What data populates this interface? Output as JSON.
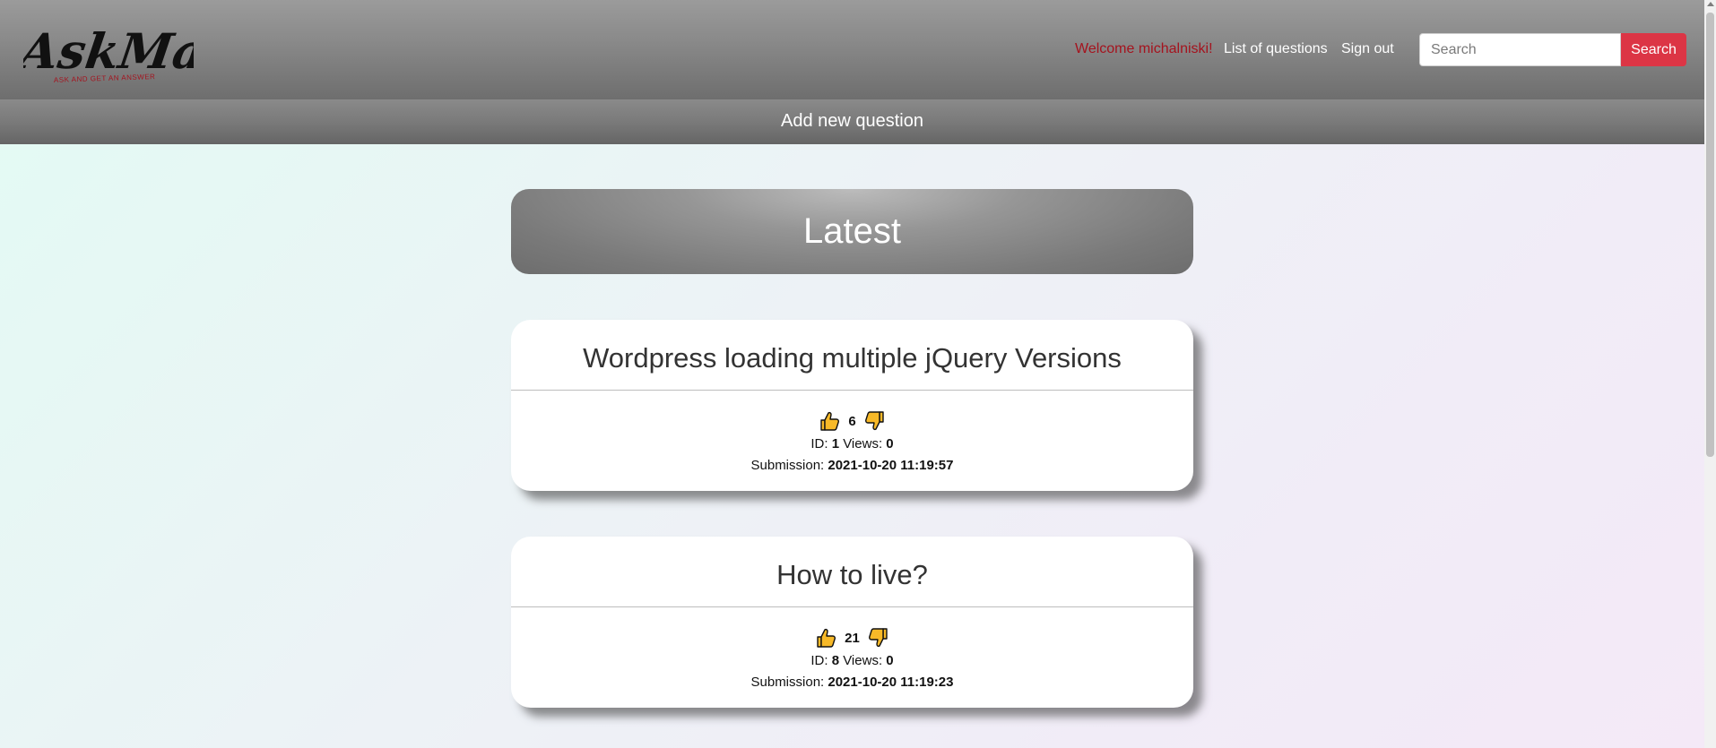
{
  "header": {
    "logo": {
      "title": "AskMate",
      "tagline": "ASK AND GET AN ANSWER"
    },
    "welcome": "Welcome michalniski!",
    "nav": {
      "questions": "List of questions",
      "signout": "Sign out"
    },
    "search": {
      "placeholder": "Search",
      "value": "",
      "button": "Search"
    },
    "add_question": "Add new question"
  },
  "main": {
    "section_title": "Latest",
    "labels": {
      "id": "ID:",
      "views": "Views:",
      "submission": "Submission:"
    },
    "questions": [
      {
        "title": "Wordpress loading multiple jQuery Versions",
        "votes": "6",
        "id": "1",
        "views": "0",
        "submission": "2021-10-20 11:19:57"
      },
      {
        "title": "How to live?",
        "votes": "21",
        "id": "8",
        "views": "0",
        "submission": "2021-10-20 11:19:23"
      }
    ]
  },
  "icons": {
    "upvote": "thumbs-up-icon",
    "downvote": "thumbs-down-icon"
  },
  "colors": {
    "accent": "#dc3545",
    "welcome": "#a5131e",
    "thumb_fill": "#f7b928"
  }
}
